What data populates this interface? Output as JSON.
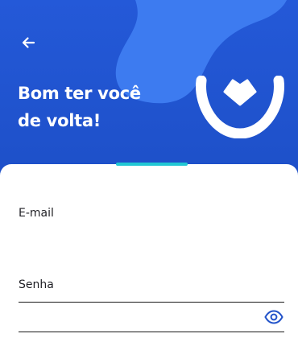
{
  "header": {
    "back_icon": "arrow-left-icon",
    "title_line1": "Bom ter você",
    "title_line2": "de volta!",
    "logo_icon": "brand-smile-heart-logo"
  },
  "form": {
    "email_label": "E-mail",
    "email_value": "",
    "password_label": "Senha",
    "password_value": "",
    "show_password_icon": "eye-icon"
  },
  "colors": {
    "header_blue": "#1d4fc7",
    "wave_blue": "#3d7bf0",
    "accent_teal": "#21c7d4",
    "icon_blue": "#2152c9"
  }
}
